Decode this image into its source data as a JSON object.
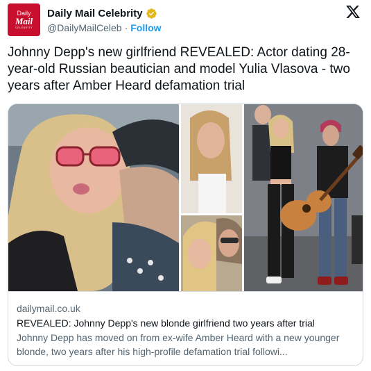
{
  "author": {
    "display_name": "Daily Mail Celebrity",
    "handle": "@DailyMailCeleb",
    "separator": "·",
    "follow_label": "Follow",
    "avatar_text": {
      "line1": "Daily",
      "line2": "Mail",
      "line3": "CELEBRITY"
    },
    "verified_icon": "verified-gold-badge",
    "brand_color": "#c8102e"
  },
  "platform_icon": "x-logo-icon",
  "tweet": {
    "text": "Johnny Depp's new girlfriend REVEALED: Actor dating 28-year-old Russian beautician and model Yulia Vlasova - two years after Amber Heard defamation trial"
  },
  "card": {
    "domain": "dailymail.co.uk",
    "title": "REVEALED: Johnny Depp's new blonde girlfriend two years after trial",
    "description": "Johnny Depp has moved on from ex-wife Amber Heard with a new younger blonde, two years after his high-profile defamation trial followi..."
  },
  "colors": {
    "text": "#0f1419",
    "secondary": "#536471",
    "link": "#1d9bf0",
    "border": "#cfd9de",
    "verified_gold": "#e2b719"
  }
}
